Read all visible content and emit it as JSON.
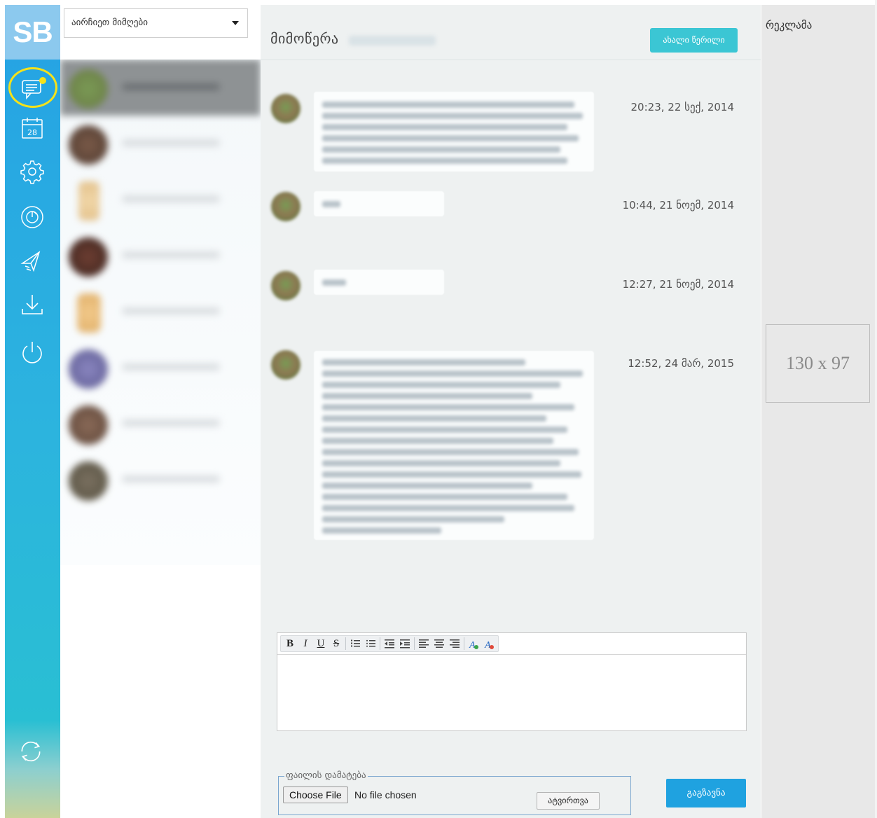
{
  "logo": {
    "text": "SB"
  },
  "rail": {
    "icons": [
      "messages-icon",
      "calendar-icon",
      "settings-icon",
      "stats-icon",
      "share-icon",
      "download-icon",
      "power-icon",
      "refresh-icon"
    ],
    "calendar_day": "28"
  },
  "contacts": {
    "select_label": "აირჩიეთ მიმღები"
  },
  "thread": {
    "title": "მიმოწერა",
    "new_message_label": "ახალი წერილი",
    "messages": [
      {
        "timestamp": "20:23, 22 სექ, 2014"
      },
      {
        "timestamp": "10:44, 21 ნოემ, 2014"
      },
      {
        "timestamp": "12:27, 21 ნოემ, 2014"
      },
      {
        "timestamp": "12:52, 24 მარ, 2015"
      }
    ]
  },
  "editor": {
    "toolbar": {
      "bold": "B",
      "italic": "I",
      "underline": "U",
      "strike": "S"
    }
  },
  "attachment": {
    "legend": "ფაილის დამატება",
    "choose_label": "Choose File",
    "no_file_label": "No file chosen",
    "upload_label": "ატვირთვა"
  },
  "send_label": "გაგზავნა",
  "ads": {
    "title": "რეკლამა",
    "placeholder": "130 x 97"
  },
  "colors": {
    "rail_top": "#25a2e4",
    "accent_teal": "#3bc6d4",
    "send_blue": "#1fa2e0",
    "highlight_yellow": "#f5e21a"
  }
}
